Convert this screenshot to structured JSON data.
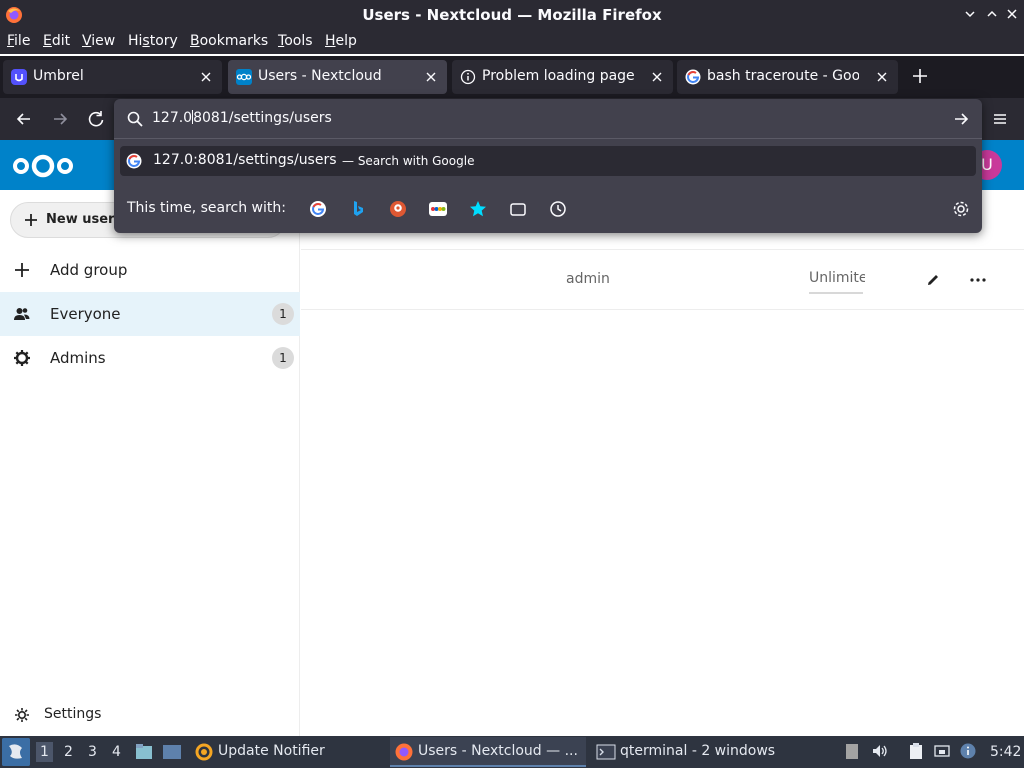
{
  "window": {
    "title": "Users - Nextcloud — Mozilla Firefox"
  },
  "menubar": {
    "items": [
      {
        "label": "File",
        "accel": "F",
        "rest": "ile"
      },
      {
        "label": "Edit",
        "accel": "E",
        "rest": "dit"
      },
      {
        "label": "View",
        "accel": "V",
        "rest": "iew"
      },
      {
        "label": "History",
        "pre": "Hi",
        "accel": "s",
        "rest": "tory"
      },
      {
        "label": "Bookmarks",
        "accel": "B",
        "rest": "ookmarks"
      },
      {
        "label": "Tools",
        "accel": "T",
        "rest": "ools"
      },
      {
        "label": "Help",
        "accel": "H",
        "rest": "elp"
      }
    ]
  },
  "tabs": [
    {
      "label": "Umbrel",
      "icon": "umbrel-icon",
      "active": false
    },
    {
      "label": "Users - Nextcloud",
      "icon": "nextcloud-icon",
      "active": true
    },
    {
      "label": "Problem loading page",
      "icon": "info-icon",
      "active": false
    },
    {
      "label": "bash traceroute - Google",
      "icon": "google-icon",
      "active": false
    }
  ],
  "urlbar": {
    "value_before_cursor": "127.0",
    "value_after_cursor": "8081/settings/users",
    "suggestion_main": "127.0:8081/settings/users",
    "suggestion_sub": "— Search with Google",
    "engines_label": "This time, search with:",
    "engines": [
      "google-engine-icon",
      "bing-engine-icon",
      "duckduckgo-engine-icon",
      "ebay-engine-icon",
      "bookmarks-icon",
      "tabs-icon",
      "history-icon"
    ]
  },
  "nextcloud": {
    "avatar_letter": "U",
    "new_user_label": "New user",
    "add_group_label": "Add group",
    "groups": [
      {
        "label": "Everyone",
        "count": "1",
        "selected": true
      },
      {
        "label": "Admins",
        "count": "1",
        "selected": false
      }
    ],
    "settings_label": "Settings",
    "user_row": {
      "username": "admin",
      "quota": "Unlimited"
    }
  },
  "taskbar": {
    "workspaces": [
      "1",
      "2",
      "3",
      "4"
    ],
    "current_workspace": "1",
    "tasks": [
      {
        "label": "Update Notifier",
        "active": false
      },
      {
        "label": "Users - Nextcloud — ...",
        "active": true
      },
      {
        "label": "qterminal - 2 windows",
        "active": false
      }
    ],
    "clock": "5:42"
  },
  "colors": {
    "nextcloud_blue": "#0082c9",
    "firefox_chrome": "#2b2a33",
    "avatar_bg": "#c9399a",
    "selected_group_bg": "#e6f3fa"
  }
}
